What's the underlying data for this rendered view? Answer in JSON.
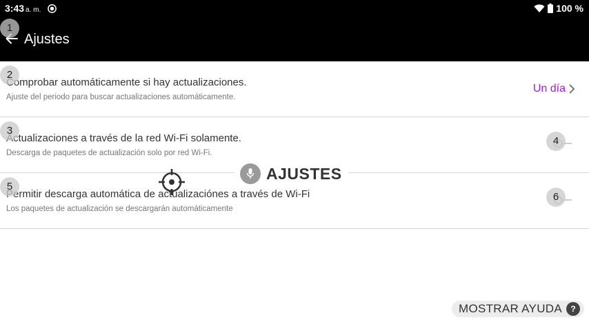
{
  "status_bar": {
    "time": "3:43",
    "ampm": "a. m.",
    "battery": "100 %"
  },
  "app_bar": {
    "title": "Ajustes"
  },
  "settings": [
    {
      "badge": "2",
      "title": "Comprobar automáticamente si hay actualizaciones.",
      "subtitle": "Ajuste del periodo para buscar actualizaciones automáticamente.",
      "value": "Un día"
    },
    {
      "badge": "3",
      "title": "Actualizaciones a través de la red Wi-Fi solamente.",
      "subtitle": "Descarga de paquetes de actualización solo por red Wi-Fi.",
      "toggle_badge": "4",
      "toggle_on": false
    },
    {
      "badge": "5",
      "title": "Permitir descarga automática de actualizaciónes a través de Wi-Fi",
      "subtitle": "Los paquetes de actualización se descargarán automáticamente",
      "toggle_badge": "6",
      "toggle_on": false
    }
  ],
  "back_badge": "1",
  "overlay": {
    "label": "AJUSTES"
  },
  "help": {
    "label": "MOSTRAR AYUDA",
    "icon_text": "?"
  },
  "colors": {
    "accent": "#9b1de0",
    "bar": "#000000"
  }
}
